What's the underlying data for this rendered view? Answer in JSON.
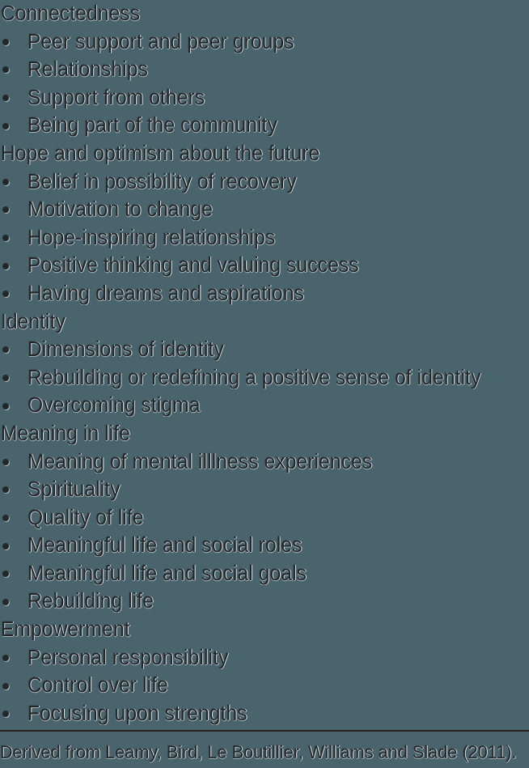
{
  "slide": {
    "background_color": "#4a646d",
    "text_color": "#23272a",
    "highlight_color": "#e9eef0",
    "rule_color": "#2a2320",
    "bullet_glyph": "bullet-dot"
  },
  "sections": [
    {
      "heading": "Connectedness",
      "items": [
        "Peer support and peer groups",
        "Relationships",
        "Support from others",
        "Being part of the community"
      ]
    },
    {
      "heading": "Hope and optimism about the future",
      "items": [
        "Belief in possibility of recovery",
        "Motivation to change",
        "Hope-inspiring relationships",
        "Positive thinking and valuing success",
        "Having dreams and aspirations"
      ]
    },
    {
      "heading": "Identity",
      "items": [
        "Dimensions of identity",
        "Rebuilding or redefining a positive sense of identity",
        "Overcoming stigma"
      ]
    },
    {
      "heading": "Meaning in life",
      "items": [
        "Meaning of mental illlness experiences",
        "Spirituality",
        "Quality of life",
        "Meaningful life and social roles",
        "Meaningful life and social goals",
        "Rebuilding life"
      ]
    },
    {
      "heading": "Empowerment",
      "items": [
        "Personal responsibility",
        "Control over life",
        "Focusing upon strengths"
      ]
    }
  ],
  "footer": {
    "attribution": "Derived from Leamy, Bird, Le Boutillier, Williams and Slade (2011)."
  }
}
